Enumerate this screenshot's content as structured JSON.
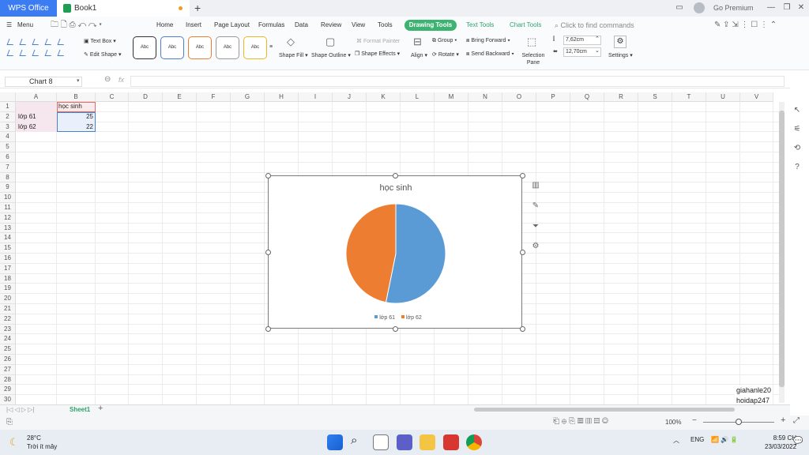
{
  "titlebar": {
    "app_name": "WPS Office",
    "doc_name": "Book1",
    "premium_label": "Go Premium"
  },
  "menu": {
    "menu_label": "Menu",
    "tabs": [
      "Home",
      "Insert",
      "Page Layout",
      "Formulas",
      "Data",
      "Review",
      "View",
      "Tools"
    ],
    "active_tab": "Drawing Tools",
    "context_tabs": [
      "Text Tools",
      "Chart Tools"
    ],
    "search_placeholder": "Click to find commands"
  },
  "ribbon": {
    "text_box": "Text Box",
    "edit_shape": "Edit Shape",
    "style_sample": "Abc",
    "shape_fill": "Shape Fill",
    "shape_outline": "Shape Outline",
    "format_painter": "Format Painter",
    "shape_effects": "Shape Effects",
    "group": "Group",
    "bring_forward": "Bring Forward",
    "align": "Align",
    "rotate": "Rotate",
    "send_backward": "Send Backward",
    "selection_pane": "Selection Pane",
    "height_value": "7,62cm",
    "width_value": "12,70cm",
    "settings": "Settings"
  },
  "formula_bar": {
    "name_box": "Chart 8",
    "fx": "fx",
    "formula": ""
  },
  "grid": {
    "columns": [
      "A",
      "B",
      "C",
      "D",
      "E",
      "F",
      "G",
      "H",
      "I",
      "J",
      "K",
      "L",
      "M",
      "N",
      "O",
      "P",
      "Q",
      "R",
      "S",
      "T",
      "U",
      "V"
    ],
    "rows": [
      "1",
      "2",
      "3",
      "4",
      "5",
      "6",
      "7",
      "8",
      "9",
      "10",
      "11",
      "12",
      "13",
      "14",
      "15",
      "16",
      "17",
      "18",
      "19",
      "20",
      "21",
      "22",
      "23",
      "24",
      "25",
      "26",
      "27",
      "28",
      "29",
      "30"
    ],
    "cells": {
      "B1": "học sinh",
      "A2": "lớp 61",
      "B2": "25",
      "A3": "lớp 62",
      "B3": "22"
    },
    "watermark_1": "giahanle20",
    "watermark_2": "hoidap247"
  },
  "chart_data": {
    "type": "pie",
    "title": "học sinh",
    "categories": [
      "lớp 61",
      "lớp 62"
    ],
    "values": [
      25,
      22
    ],
    "colors": [
      "#5b9bd5",
      "#ed7d31"
    ],
    "legend": "bottom"
  },
  "sheetbar": {
    "sheet_name": "Sheet1"
  },
  "statusbar": {
    "zoom": "100%"
  },
  "taskbar": {
    "temperature": "28°C",
    "weather": "Trời ít mây",
    "language": "ENG",
    "time": "8:59 CH",
    "date": "23/03/2022"
  }
}
